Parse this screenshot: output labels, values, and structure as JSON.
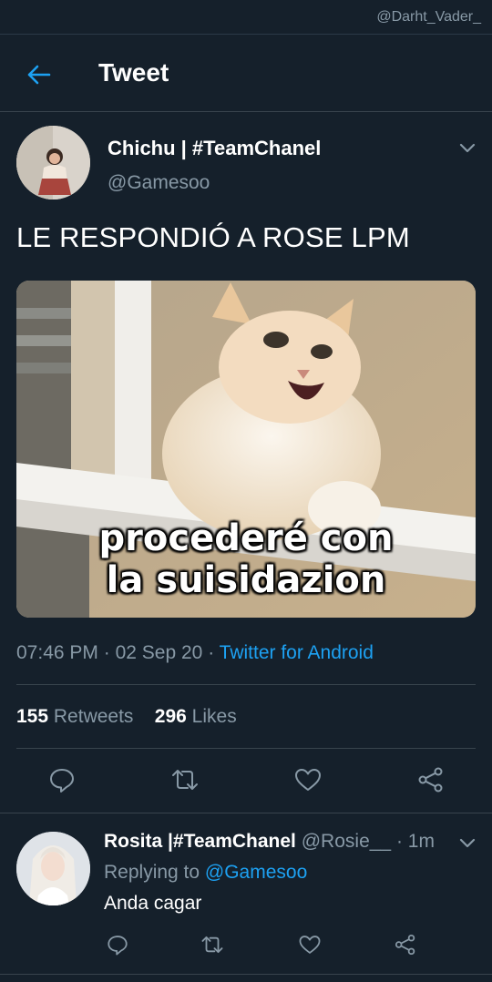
{
  "watermark": "@Darht_Vader_",
  "header": {
    "title": "Tweet",
    "back_icon": "arrow-left-icon"
  },
  "tweet": {
    "author_name": "Chichu | #TeamChanel",
    "author_handle": "@Gamesoo",
    "text": "LE RESPONDIÓ A ROSE LPM",
    "media_caption": [
      "procederé con",
      "la suisidazion"
    ],
    "time": "07:46 PM",
    "date": "02 Sep 20",
    "separator": "·",
    "source": "Twitter for Android",
    "retweets_count": "155",
    "retweets_label": "Retweets",
    "likes_count": "296",
    "likes_label": "Likes",
    "actions": [
      "reply-icon",
      "retweet-icon",
      "like-icon",
      "share-icon"
    ]
  },
  "reply": {
    "author_name": "Rosita |#TeamChanel",
    "author_handle": "@Rosie__",
    "time": "1m",
    "replying_label": "Replying to",
    "replying_to": "@Gamesoo",
    "text": "Anda cagar"
  },
  "colors": {
    "background": "#15202b",
    "accent": "#1da1f2",
    "secondary_text": "#8899a6",
    "divider": "#38444d"
  }
}
